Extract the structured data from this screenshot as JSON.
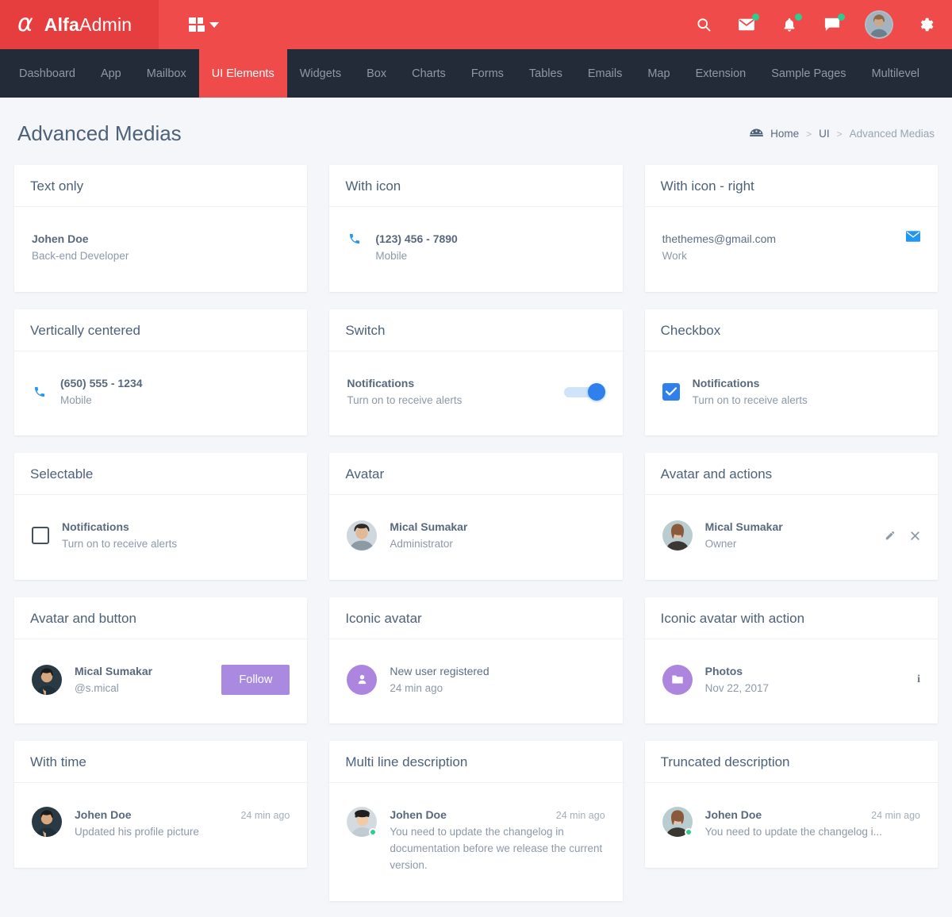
{
  "topbar": {
    "brand_mark": "alpha-glyph",
    "brand_bold": "Alfa",
    "brand_light": "Admin",
    "grid_toggle": "grid-toggle-icon",
    "icons": [
      {
        "name": "search-icon",
        "badge": false
      },
      {
        "name": "mail-icon",
        "badge": true
      },
      {
        "name": "bell-icon",
        "badge": true
      },
      {
        "name": "chat-icon",
        "badge": true
      }
    ],
    "avatar": "user-avatar",
    "settings": "gear-icon"
  },
  "nav": {
    "items": [
      {
        "label": "Dashboard",
        "active": false
      },
      {
        "label": "App",
        "active": false
      },
      {
        "label": "Mailbox",
        "active": false
      },
      {
        "label": "UI Elements",
        "active": true
      },
      {
        "label": "Widgets",
        "active": false
      },
      {
        "label": "Box",
        "active": false
      },
      {
        "label": "Charts",
        "active": false
      },
      {
        "label": "Forms",
        "active": false
      },
      {
        "label": "Tables",
        "active": false
      },
      {
        "label": "Emails",
        "active": false
      },
      {
        "label": "Map",
        "active": false
      },
      {
        "label": "Extension",
        "active": false
      },
      {
        "label": "Sample Pages",
        "active": false
      },
      {
        "label": "Multilevel",
        "active": false
      }
    ]
  },
  "page": {
    "title": "Advanced Medias",
    "breadcrumb": {
      "home_icon": "dashboard-icon",
      "home": "Home",
      "sep1": ">",
      "section": "UI",
      "sep2": ">",
      "current": "Advanced Medias"
    }
  },
  "cards": {
    "text_only": {
      "title": "Text only",
      "name": "Johen Doe",
      "role": "Back-end Developer"
    },
    "with_icon": {
      "title": "With icon",
      "icon": "phone-icon",
      "value": "(123) 456 - 7890",
      "label": "Mobile"
    },
    "with_icon_right": {
      "title": "With icon - right",
      "icon": "envelope-icon",
      "value": "thethemes@gmail.com",
      "label": "Work"
    },
    "vertically_centered": {
      "title": "Vertically centered",
      "icon": "phone-icon",
      "value": "(650) 555 - 1234",
      "label": "Mobile"
    },
    "switch": {
      "title": "Switch",
      "name": "Notifications",
      "desc": "Turn on to receive alerts",
      "state": "on"
    },
    "checkbox": {
      "title": "Checkbox",
      "name": "Notifications",
      "desc": "Turn on to receive alerts",
      "state": "checked"
    },
    "selectable": {
      "title": "Selectable",
      "name": "Notifications",
      "desc": "Turn on to receive alerts",
      "state": "unchecked"
    },
    "avatar": {
      "title": "Avatar",
      "name": "Mical Sumakar",
      "role": "Administrator"
    },
    "avatar_actions": {
      "title": "Avatar and actions",
      "name": "Mical Sumakar",
      "role": "Owner",
      "action_edit": "pencil-icon",
      "action_close": "close-icon"
    },
    "avatar_button": {
      "title": "Avatar and button",
      "name": "Mical Sumakar",
      "handle": "@s.mical",
      "button": "Follow"
    },
    "iconic_avatar": {
      "title": "Iconic avatar",
      "icon": "person-icon",
      "name": "New user registered",
      "time": "24 min ago"
    },
    "iconic_avatar_action": {
      "title": "Iconic avatar with action",
      "icon": "folder-icon",
      "name": "Photos",
      "date": "Nov 22, 2017",
      "action": "info-icon"
    },
    "with_time": {
      "title": "With time",
      "name": "Johen Doe",
      "desc": "Updated his profile picture",
      "time": "24 min ago"
    },
    "multi_line": {
      "title": "Multi line description",
      "name": "Johen Doe",
      "time": "24 min ago",
      "desc": "You need to update the changelog in documentation before we release the current version."
    },
    "truncated": {
      "title": "Truncated description",
      "name": "Johen Doe",
      "time": "24 min ago",
      "desc": "You need to update the changelog i..."
    }
  },
  "colors": {
    "brand_red": "#ef4b4b",
    "nav_dark": "#232b38",
    "page_bg": "#f4f6f9",
    "accent_blue": "#2f80ed",
    "accent_purple": "#ad85de",
    "status_green": "#2ecc8f",
    "text_dark": "#4d6179",
    "text_muted": "#8d99a8"
  }
}
